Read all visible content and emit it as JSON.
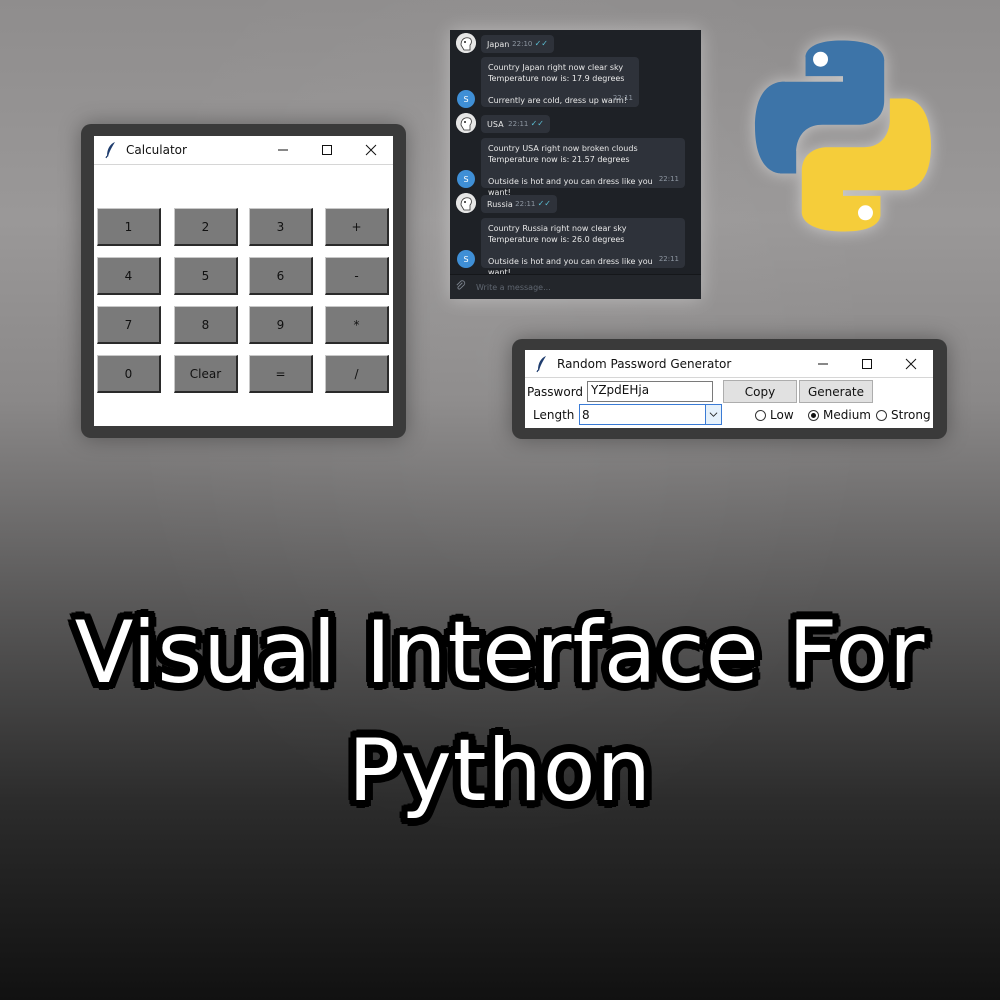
{
  "calculator": {
    "title": "Calculator",
    "display": "",
    "buttons": [
      [
        "1",
        "2",
        "3",
        "+"
      ],
      [
        "4",
        "5",
        "6",
        "-"
      ],
      [
        "7",
        "8",
        "9",
        "*"
      ],
      [
        "0",
        "Clear",
        "=",
        "/"
      ]
    ]
  },
  "chat": {
    "messages": [
      {
        "from": "bot",
        "text": "Japan",
        "time": "22:10"
      },
      {
        "from": "s",
        "lines": [
          "Country Japan right now clear sky",
          "Temperature now is: 17.9 degrees",
          "",
          "Currently are cold, dress up warm!"
        ],
        "time": "22:11"
      },
      {
        "from": "bot",
        "text": "USA",
        "time": "22:11"
      },
      {
        "from": "s",
        "lines": [
          "Country USA right now broken clouds",
          "Temperature now is: 21.57 degrees",
          "",
          "Outside is hot and you can dress like you want!"
        ],
        "time": "22:11"
      },
      {
        "from": "bot",
        "text": "Russia",
        "time": "22:11"
      },
      {
        "from": "s",
        "lines": [
          "Country Russia right now clear sky",
          "Temperature now is: 26.0 degrees",
          "",
          "Outside is hot and you can dress like you want!"
        ],
        "time": "22:11"
      }
    ],
    "avatar_letter": "S",
    "input_placeholder": "Write a message..."
  },
  "password_generator": {
    "title": "Random Password Generator",
    "password_label": "Password",
    "password_value": "YZpdEHja",
    "copy_label": "Copy",
    "generate_label": "Generate",
    "length_label": "Length",
    "length_value": "8",
    "strength_options": [
      "Low",
      "Medium",
      "Strong"
    ],
    "selected_strength": "Medium"
  },
  "headline": {
    "line1": "Visual Interface For",
    "line2": "Python"
  },
  "colors": {
    "python_blue": "#3d74a8",
    "python_yellow": "#f5cd3a",
    "chat_bg": "#1e2126",
    "calc_button": "#7a7a7a"
  }
}
